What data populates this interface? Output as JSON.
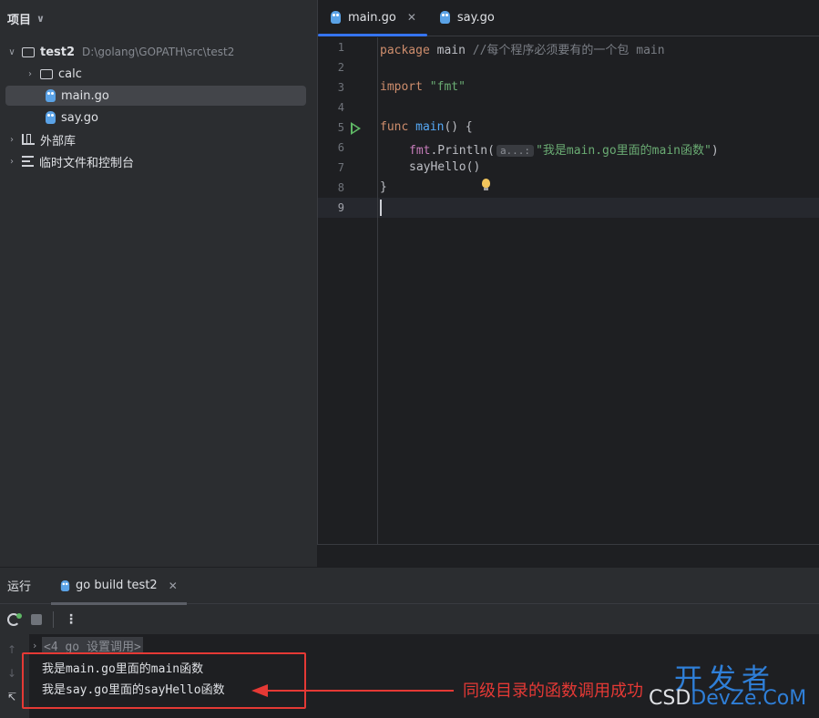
{
  "project": {
    "title": "项目",
    "tree": [
      {
        "label": "test2",
        "path": "D:\\golang\\GOPATH\\src\\test2"
      },
      {
        "label": "calc"
      },
      {
        "label": "main.go"
      },
      {
        "label": "say.go"
      },
      {
        "label": "外部库"
      },
      {
        "label": "临时文件和控制台"
      }
    ]
  },
  "editor": {
    "tabs": [
      {
        "label": "main.go",
        "active": true
      },
      {
        "label": "say.go",
        "active": false
      }
    ],
    "line_numbers": [
      "1",
      "2",
      "3",
      "4",
      "5",
      "6",
      "7",
      "8",
      "9"
    ],
    "code": {
      "l1_kw": "package",
      "l1_name": " main ",
      "l1_comment": "//每个程序必须要有的一个包 main",
      "l3_kw": "import",
      "l3_str": " \"fmt\"",
      "l5_kw": "func",
      "l5_fn": " main",
      "l5_rest": "() {",
      "l6_pkg": "fmt",
      "l6_call": ".Println(",
      "l6_hint": "a...:",
      "l6_str": "\"我是main.go里面的main函数\"",
      "l6_close": ")",
      "l7": "sayHello()",
      "l8": "}"
    }
  },
  "run": {
    "title": "运行",
    "tab_label": "go build test2",
    "console": {
      "command": "<4 go 设置调用>",
      "lines": [
        "我是main.go里面的main函数",
        "我是say.go里面的sayHello函数"
      ]
    }
  },
  "annotation": {
    "text": "同级目录的函数调用成功",
    "color": "#e53935"
  },
  "watermark": {
    "cn": "开发者",
    "prefix": "CSD",
    "site": "DevZe.CoM"
  }
}
